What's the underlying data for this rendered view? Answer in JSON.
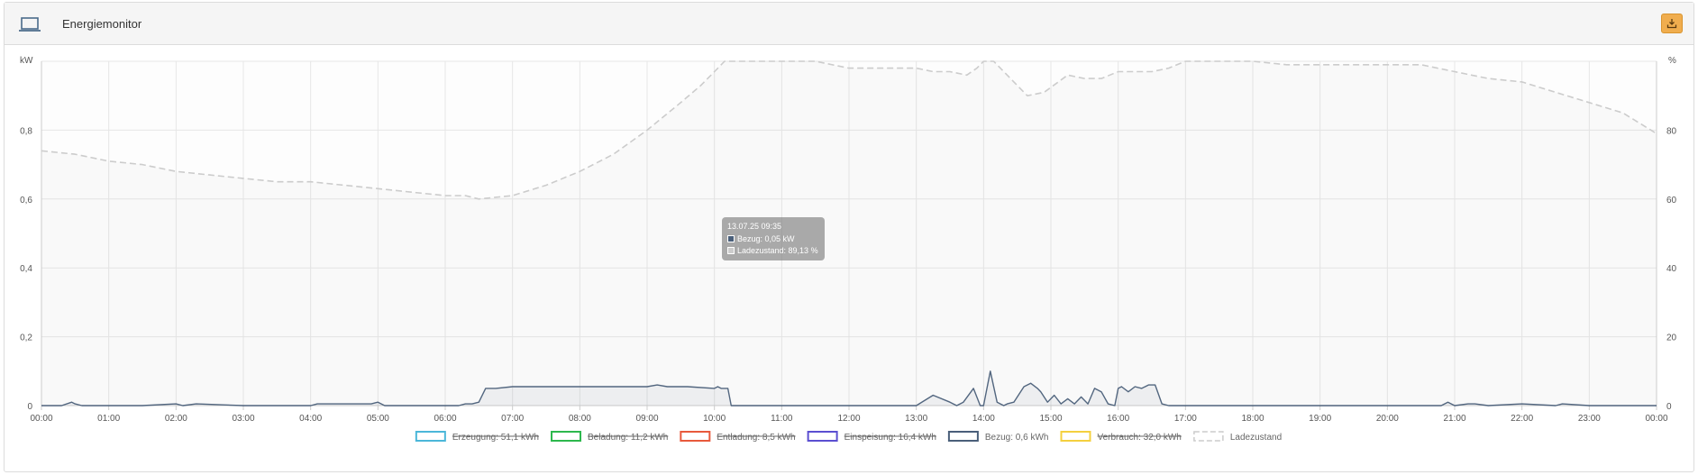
{
  "header": {
    "title": "Energiemonitor",
    "icon": "laptop-icon",
    "download_icon": "download-icon",
    "download_color": "#f0ad4e"
  },
  "tooltip": {
    "title": "13.07.25 09:35",
    "rows": [
      {
        "label": "Bezug: 0,05 kW",
        "color": "#4a5f7a"
      },
      {
        "label": "Ladezustand: 89,13 %",
        "color": "#cccccc"
      }
    ]
  },
  "chart_data": {
    "type": "line",
    "x_ticks": [
      "00:00",
      "01:00",
      "02:00",
      "03:00",
      "04:00",
      "05:00",
      "06:00",
      "07:00",
      "08:00",
      "09:00",
      "10:00",
      "11:00",
      "12:00",
      "13:00",
      "14:00",
      "15:00",
      "16:00",
      "17:00",
      "18:00",
      "19:00",
      "20:00",
      "21:00",
      "22:00",
      "23:00",
      "00:00"
    ],
    "y_left": {
      "unit": "kW",
      "ticks": [
        "0",
        "0,2",
        "0,4",
        "0,6",
        "0,8"
      ],
      "range": [
        0,
        1.0
      ]
    },
    "y_right": {
      "unit": "%",
      "ticks": [
        "0",
        "20",
        "40",
        "60",
        "80"
      ],
      "range": [
        0,
        100
      ]
    },
    "grid": true,
    "legend_position": "bottom",
    "legend": [
      {
        "label": "Erzeugung: 51,1 kWh",
        "color": "#4bb7d9",
        "hidden": true,
        "style": "solid"
      },
      {
        "label": "Beladung: 11,2 kWh",
        "color": "#2db84d",
        "hidden": true,
        "style": "solid"
      },
      {
        "label": "Entladung: 8,5 kWh",
        "color": "#e8593c",
        "hidden": true,
        "style": "solid"
      },
      {
        "label": "Einspeisung: 16,4 kWh",
        "color": "#5b4fd1",
        "hidden": true,
        "style": "solid"
      },
      {
        "label": "Bezug: 0,6 kWh",
        "color": "#4a5f7a",
        "hidden": false,
        "style": "solid"
      },
      {
        "label": "Verbrauch: 32,0 kWh",
        "color": "#f4d03f",
        "hidden": true,
        "style": "solid"
      },
      {
        "label": "Ladezustand",
        "color": "#cccccc",
        "hidden": false,
        "style": "dashed"
      }
    ],
    "series": [
      {
        "name": "Bezug",
        "axis": "left",
        "color": "#4a5f7a",
        "fill": "rgba(74,95,122,0.07)",
        "x_hours": [
          0,
          0.3,
          0.45,
          0.5,
          0.6,
          1,
          1.5,
          2,
          2.1,
          2.3,
          3,
          3.5,
          4,
          4.1,
          4.5,
          4.9,
          5,
          5.1,
          5.5,
          6,
          6.2,
          6.3,
          6.4,
          6.5,
          6.6,
          6.75,
          7,
          7.5,
          8,
          8.5,
          9,
          9.15,
          9.3,
          9.6,
          10,
          10.05,
          10.1,
          10.2,
          10.25,
          11,
          12,
          13,
          13.25,
          13.5,
          13.6,
          13.7,
          13.85,
          13.95,
          14,
          14.1,
          14.2,
          14.3,
          14.35,
          14.45,
          14.6,
          14.7,
          14.8,
          14.85,
          14.95,
          15.05,
          15.15,
          15.25,
          15.35,
          15.45,
          15.55,
          15.65,
          15.75,
          15.85,
          15.95,
          16,
          16.05,
          16.15,
          16.25,
          16.35,
          16.45,
          16.55,
          16.65,
          16.75,
          16.85,
          16.95,
          17,
          17.05,
          17.1,
          17.5,
          18,
          19,
          20,
          20.8,
          20.9,
          21,
          21.2,
          21.3,
          21.5,
          22,
          22.5,
          22.6,
          23,
          23.5,
          24
        ],
        "values": [
          0,
          0,
          0.01,
          0.005,
          0,
          0,
          0,
          0.005,
          0,
          0.005,
          0,
          0,
          0,
          0.005,
          0.005,
          0.005,
          0.01,
          0,
          0,
          0,
          0,
          0.005,
          0.005,
          0.01,
          0.05,
          0.05,
          0.055,
          0.055,
          0.055,
          0.055,
          0.055,
          0.06,
          0.055,
          0.055,
          0.05,
          0.055,
          0.05,
          0.05,
          0,
          0,
          0,
          0,
          0.03,
          0.01,
          0,
          0.01,
          0.05,
          0,
          0,
          0.1,
          0.01,
          0,
          0.005,
          0.01,
          0.055,
          0.065,
          0.05,
          0.04,
          0.01,
          0.03,
          0.005,
          0.02,
          0.005,
          0.025,
          0.005,
          0.05,
          0.04,
          0.005,
          0,
          0.05,
          0.055,
          0.04,
          0.055,
          0.05,
          0.06,
          0.06,
          0.005,
          0,
          0,
          0,
          0,
          0,
          0,
          0,
          0,
          0,
          0,
          0,
          0.01,
          0,
          0.005,
          0.005,
          0,
          0.005,
          0,
          0.005,
          0,
          0,
          0
        ],
        "step_note": ""
      },
      {
        "name": "Ladezustand",
        "axis": "right",
        "color": "#cccccc",
        "fill": "rgba(200,200,200,0.07)",
        "dashed": true,
        "x_hours": [
          0,
          0.5,
          1,
          1.5,
          2,
          2.5,
          3,
          3.5,
          4,
          4.5,
          5,
          5.5,
          6,
          6.3,
          6.5,
          7,
          7.5,
          8,
          8.5,
          9,
          9.5,
          9.8,
          10,
          10.15,
          10.5,
          11,
          11.5,
          12,
          12.5,
          13,
          13.25,
          13.5,
          13.75,
          13.9,
          14,
          14.15,
          14.4,
          14.65,
          14.9,
          15.25,
          15.5,
          15.75,
          16,
          16.25,
          16.5,
          16.75,
          17,
          17.25,
          17.5,
          18,
          18.5,
          19,
          20,
          20.5,
          21,
          21.5,
          22,
          22.5,
          23,
          23.5,
          24
        ],
        "values": [
          74,
          73,
          71,
          70,
          68,
          67,
          66,
          65,
          65,
          64,
          63,
          62,
          61,
          61,
          60,
          61,
          64,
          68,
          73,
          80,
          88,
          93,
          97,
          100,
          100,
          100,
          100,
          98,
          98,
          98,
          97,
          97,
          96,
          98,
          100,
          100,
          95,
          90,
          91,
          96,
          95,
          95,
          97,
          97,
          97,
          98,
          100,
          100,
          100,
          100,
          99,
          99,
          99,
          99,
          97,
          95,
          94,
          91,
          88,
          85,
          79
        ]
      }
    ]
  }
}
